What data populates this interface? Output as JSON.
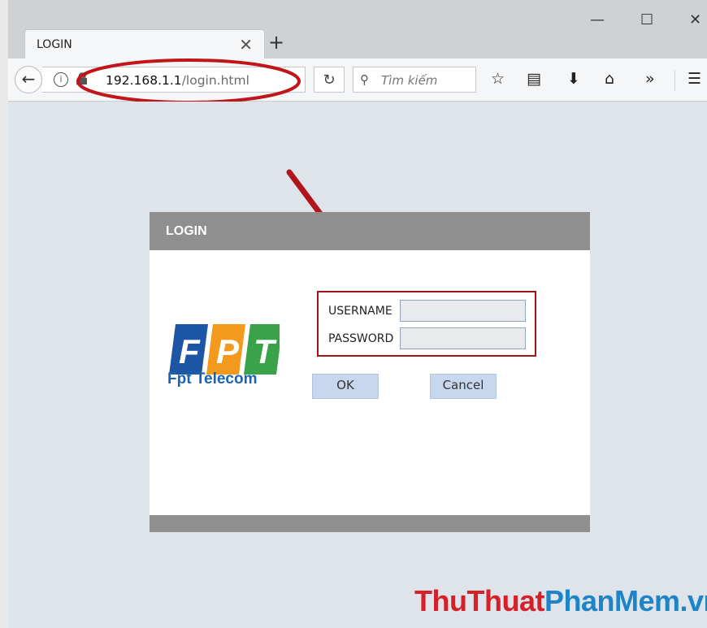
{
  "browser": {
    "tab_title": "LOGIN",
    "tab_close_glyph": "✕",
    "new_tab_glyph": "+",
    "window_controls": {
      "minimize": "—",
      "maximize": "☐",
      "close": "✕"
    },
    "url_host": "192.168.1.1",
    "url_path": "/login.html",
    "search_placeholder": "Tìm kiếm",
    "icons": [
      "back-arrow-icon",
      "info-icon",
      "insecure-lock-icon",
      "reload-icon",
      "search-icon",
      "bookmark-star-icon",
      "reading-list-icon",
      "download-icon",
      "home-icon",
      "overflow-chevrons-icon",
      "hamburger-menu-icon"
    ]
  },
  "annotation": {
    "color": "#c0161b"
  },
  "login": {
    "header": "LOGIN",
    "brand_letters": [
      "F",
      "P",
      "T"
    ],
    "brand_colors": [
      "#1e56a6",
      "#f39a1e",
      "#3aa349"
    ],
    "brand_subtitle": "Fpt Telecom",
    "username_label": "USERNAME",
    "password_label": "PASSWORD",
    "username_value": "",
    "password_value": "",
    "ok_label": "OK",
    "cancel_label": "Cancel"
  },
  "watermark": {
    "part1": "ThuThuat",
    "part2": "PhanMem.vn",
    "color1": "#d5202a",
    "color2": "#1d84c7"
  }
}
